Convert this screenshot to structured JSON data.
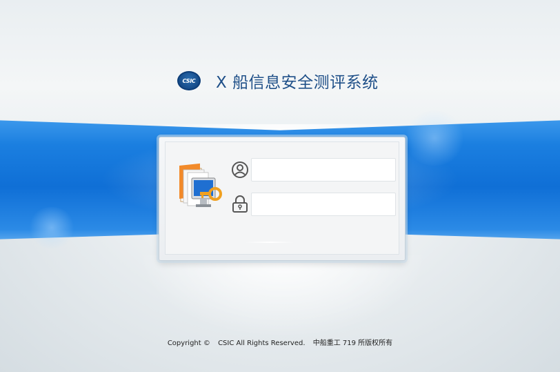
{
  "header": {
    "logo_text": "CSIC",
    "title": "X 船信息安全测评系统"
  },
  "login": {
    "username_icon": "user-icon",
    "username_value": "",
    "password_icon": "lock-icon",
    "password_value": ""
  },
  "footer": {
    "copyright": "Copyright ©",
    "rights": "CSIC All Rights Reserved.",
    "owner": "中船重工 719 所版权所有"
  },
  "colors": {
    "band_blue": "#0f6fd6",
    "title_blue": "#1e4f88"
  }
}
